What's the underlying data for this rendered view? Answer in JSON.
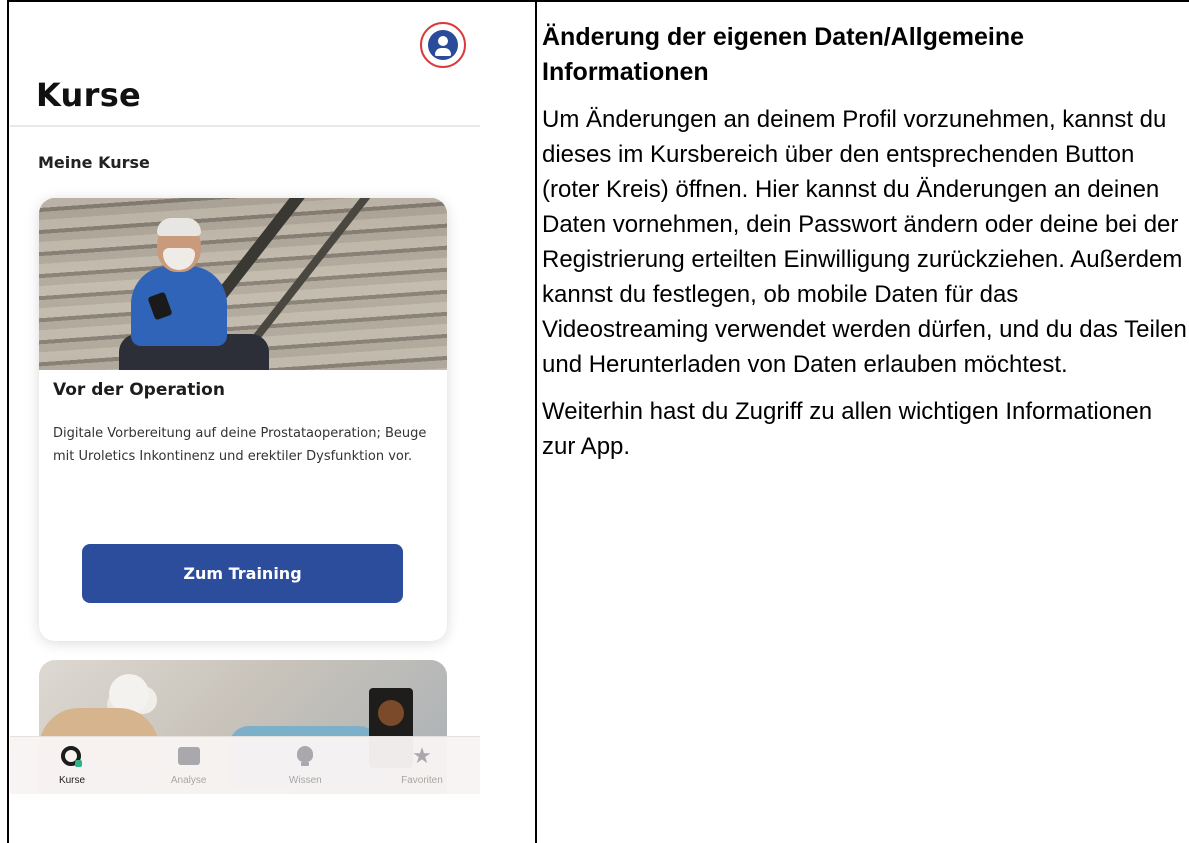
{
  "app": {
    "page_title": "Kurse",
    "section_title": "Meine Kurse",
    "profile_button_icon": "person-icon",
    "highlight_color": "#d93a3a",
    "course_card": {
      "title": "Vor der Operation",
      "description": "Digitale Vorbereitung auf deine Prostataoperation; Beuge mit Uroletics Inkontinenz und erektiler Dysfunktion vor.",
      "button_label": "Zum Training",
      "button_color": "#2c4c9c"
    },
    "tab_bar": [
      {
        "label": "Kurse",
        "icon": "kurse-icon",
        "active": true
      },
      {
        "label": "Analyse",
        "icon": "chart-icon",
        "active": false
      },
      {
        "label": "Wissen",
        "icon": "lightbulb-icon",
        "active": false
      },
      {
        "label": "Favoriten",
        "icon": "star-icon",
        "active": false
      }
    ]
  },
  "description": {
    "heading": "Änderung der eigenen Daten/Allgemeine Informationen",
    "paragraph_1": "Um Änderungen an deinem Profil vorzunehmen, kannst du dieses im Kursbereich über den entsprechenden Button (roter Kreis) öffnen. Hier kannst du Änderungen an deinen Daten vornehmen, dein Passwort ändern oder deine bei der Registrierung erteilten Einwilligung zurückziehen. Außerdem kannst du festlegen, ob mobile Daten für das Videostreaming verwendet werden dürfen, und du das Teilen und Herunterladen von Daten erlauben möchtest.",
    "paragraph_2": "Weiterhin hast du Zugriff zu allen wichtigen Informationen zur App."
  }
}
